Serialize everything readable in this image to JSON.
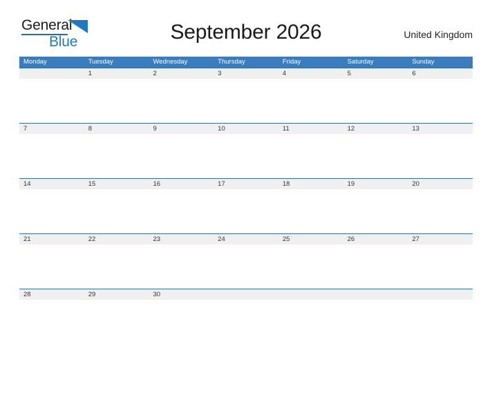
{
  "logo": {
    "word_one": "General",
    "word_two": "Blue",
    "flag_icon": "blue-triangle-flag-icon",
    "accent_color": "#1f7ac4"
  },
  "header": {
    "title": "September 2026",
    "country": "United Kingdom"
  },
  "calendar": {
    "header_color": "#3a7cbe",
    "band_color": "#f0f0f0",
    "weekdays": [
      "Monday",
      "Tuesday",
      "Wednesday",
      "Thursday",
      "Friday",
      "Saturday",
      "Sunday"
    ],
    "weeks": [
      [
        "",
        "1",
        "2",
        "3",
        "4",
        "5",
        "6"
      ],
      [
        "7",
        "8",
        "9",
        "10",
        "11",
        "12",
        "13"
      ],
      [
        "14",
        "15",
        "16",
        "17",
        "18",
        "19",
        "20"
      ],
      [
        "21",
        "22",
        "23",
        "24",
        "25",
        "26",
        "27"
      ],
      [
        "28",
        "29",
        "30",
        "",
        "",
        "",
        ""
      ]
    ]
  }
}
